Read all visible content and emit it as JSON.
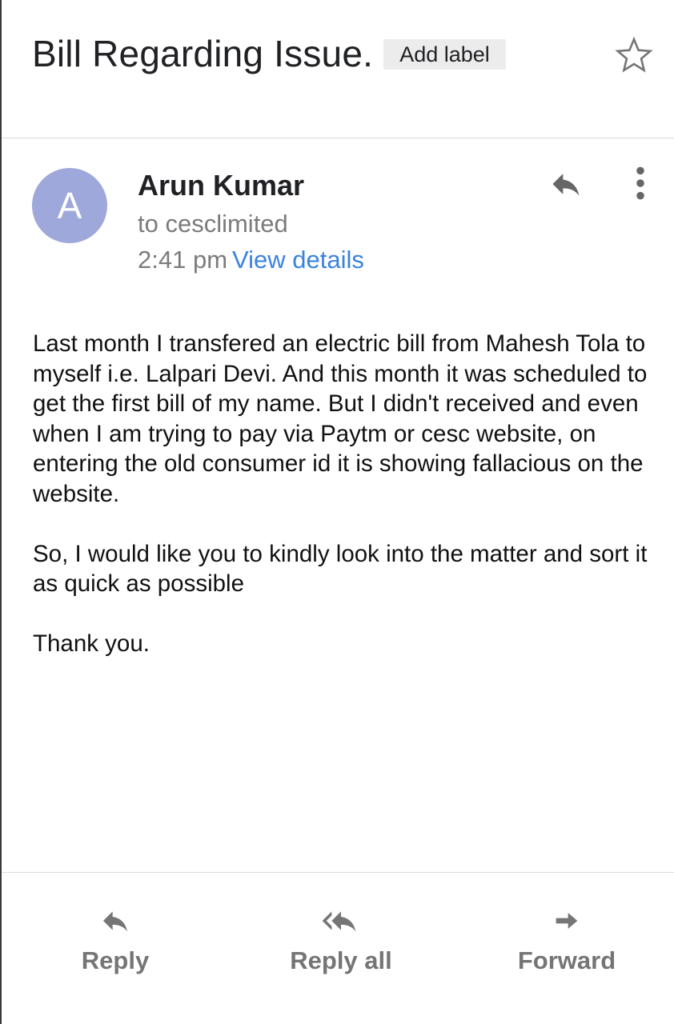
{
  "header": {
    "subject": "Bill Regarding Issue.",
    "add_label": "Add label",
    "star_icon": "star-outline-icon"
  },
  "message": {
    "avatar_letter": "A",
    "avatar_color": "#9fa8da",
    "sender": "Arun Kumar",
    "recipient": "to cesclimited",
    "time": "2:41 pm",
    "view_details": "View details",
    "link_color": "#3b82e0",
    "reply_icon": "reply-icon",
    "more_icon": "more-vert-icon",
    "body": [
      "Last month I transfered an electric bill from Mahesh Tola to myself i.e. Lalpari Devi. And this month it was scheduled to get the first bill of my name. But I didn't received and even when I am trying to pay via Paytm or cesc website, on entering the old consumer id it is showing fallacious on the website.",
      "So, I would like you to kindly look into the matter and sort it as quick as possible",
      "Thank you."
    ]
  },
  "actions": {
    "reply": "Reply",
    "reply_all": "Reply all",
    "forward": "Forward"
  }
}
